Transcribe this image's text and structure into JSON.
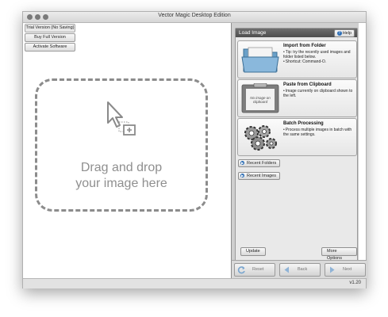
{
  "window": {
    "title": "Vector Magic Desktop Edition",
    "version": "v1.20"
  },
  "trial": {
    "status_label": "Trial Version (No Saving)",
    "buy_label": "Buy Full Version",
    "activate_label": "Activate Software"
  },
  "drop_zone": {
    "line1": "Drag and drop",
    "line2": "your image here"
  },
  "panel": {
    "title": "Load Image",
    "help_label": "Help",
    "cards": [
      {
        "title": "Import from Folder",
        "bullets": [
          "Tip: try the recently used images and folder listed below.",
          "Shortcut: Command-O."
        ]
      },
      {
        "title": "Paste from Clipboard",
        "bullets": [
          "Image currently on clipboard shown to the left."
        ],
        "thumb_text": "No image on clipboard"
      },
      {
        "title": "Batch Processing",
        "bullets": [
          "Process multiple images in batch with the same settings."
        ]
      }
    ],
    "recent_folders_label": "Recent Folders",
    "recent_images_label": "Recent Images",
    "update_label": "Update",
    "more_options_label": "More Options"
  },
  "nav": {
    "reset_label": "Reset",
    "back_label": "Back",
    "next_label": "Next"
  },
  "colors": {
    "accent": "#2f6fb6",
    "header": "#555555",
    "drop_text": "#8f8f8f"
  }
}
